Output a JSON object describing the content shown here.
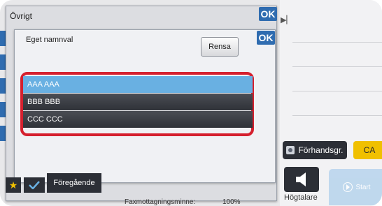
{
  "outer_dialog": {
    "title": "Övrigt",
    "ok_label": "OK"
  },
  "inner_dialog": {
    "title": "Eget namnval",
    "ok_label": "OK",
    "clear_label": "Rensa",
    "items": [
      {
        "label": "AAA AAA",
        "selected": true
      },
      {
        "label": "BBB BBB",
        "selected": false
      },
      {
        "label": "CCC CCC",
        "selected": false
      }
    ]
  },
  "right_panel": {
    "preview_label": "Förhandsgr.",
    "ca_label": "CA",
    "speaker_label": "Högtalare",
    "start_label": "Start"
  },
  "bottom": {
    "previous_label": "Föregående",
    "fax_memory_label": "Faxmottagningsminne:",
    "fax_memory_value": "100%"
  },
  "colors": {
    "accent_blue": "#2f6cb0",
    "selected_row": "#69b0e2",
    "highlight_red": "#d5202e",
    "ca_yellow": "#f0c000"
  }
}
